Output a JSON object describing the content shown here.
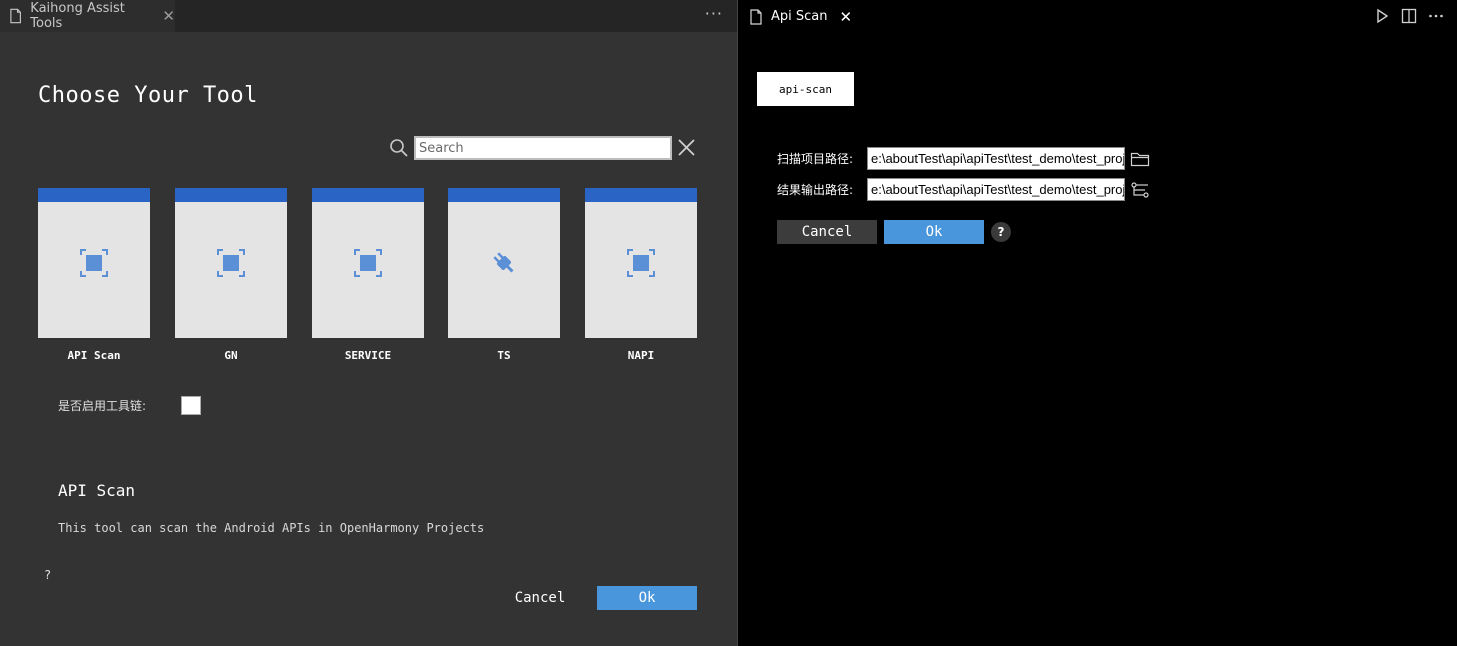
{
  "left_tab": {
    "title": "Kaihong Assist Tools",
    "close": "✕",
    "more": "···"
  },
  "tool_picker": {
    "title": "Choose Your Tool",
    "search": {
      "placeholder": "Search",
      "value": ""
    },
    "tools": [
      {
        "label": "API Scan",
        "icon": "focus-square-icon"
      },
      {
        "label": "GN",
        "icon": "focus-square-icon"
      },
      {
        "label": "SERVICE",
        "icon": "focus-square-icon"
      },
      {
        "label": "TS",
        "icon": "plug-icon"
      },
      {
        "label": "NAPI",
        "icon": "focus-square-icon"
      }
    ],
    "toolchain_label": "是否启用工具链:",
    "toolchain_checked": false,
    "description": {
      "title": "API Scan",
      "text": "This tool can scan the Android APIs in OpenHarmony Projects"
    },
    "help": "?",
    "cancel": "Cancel",
    "ok": "Ok"
  },
  "right_tab": {
    "title": "Api Scan",
    "close": "✕"
  },
  "api_scan": {
    "header": "api-scan",
    "scan_path_label": "扫描项目路径:",
    "scan_path_value": "e:\\aboutTest\\api\\apiTest\\test_demo\\test_project",
    "output_path_label": "结果输出路径:",
    "output_path_value": "e:\\aboutTest\\api\\apiTest\\test_demo\\test_project",
    "cancel": "Cancel",
    "ok": "Ok",
    "help": "?"
  },
  "colors": {
    "card_bar": "#2a64c4",
    "card_icon": "#5b8fd6",
    "ok_button": "#4a96dc",
    "left_bg": "#333333",
    "right_bg": "#000000"
  }
}
